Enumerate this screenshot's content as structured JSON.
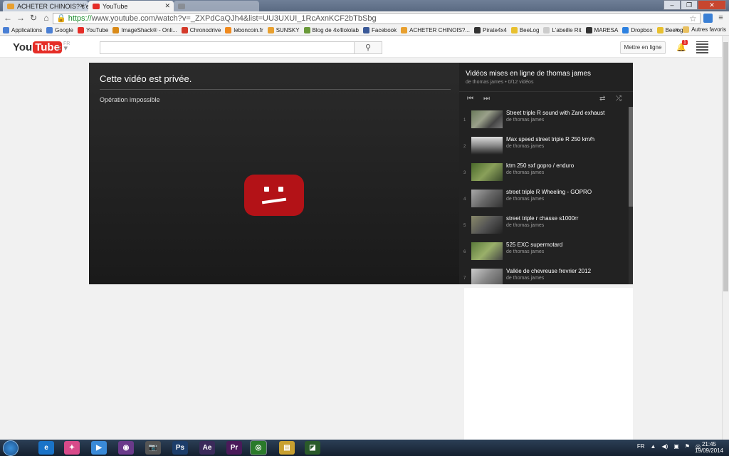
{
  "browser": {
    "tabs": [
      {
        "title": "ACHETER CHINOIS? c'est",
        "active": false,
        "favicon_color": "#e8a030"
      },
      {
        "title": "YouTube",
        "active": true,
        "favicon_color": "#e52d27"
      },
      {
        "title": "",
        "active": false,
        "favicon_color": "#999999"
      }
    ],
    "url_https": "https://",
    "url_rest": "www.youtube.com/watch?v=_ZXPdCaQJh4&list=UU3UXUI_1RcAxnKCF2bTbSbg",
    "bookmarks": [
      {
        "label": "Applications",
        "color": "#4a7fd4"
      },
      {
        "label": "Google",
        "color": "#4a7fd4"
      },
      {
        "label": "YouTube",
        "color": "#e52d27"
      },
      {
        "label": "ImageShack® - Onli...",
        "color": "#d98a18"
      },
      {
        "label": "Chronodrive",
        "color": "#d43a2a"
      },
      {
        "label": "leboncoin.fr",
        "color": "#f08a1e"
      },
      {
        "label": "SUNSKY",
        "color": "#e8a030"
      },
      {
        "label": "Blog de 4x4lololab",
        "color": "#6a9a3a"
      },
      {
        "label": "Facebook",
        "color": "#3b5998"
      },
      {
        "label": "ACHETER CHINOIS?...",
        "color": "#e8a030"
      },
      {
        "label": "Pirate4x4",
        "color": "#333333"
      },
      {
        "label": "BeeLog",
        "color": "#e8c030"
      },
      {
        "label": "L'abeille Rit",
        "color": "#cccccc"
      },
      {
        "label": "MARESA",
        "color": "#333333"
      },
      {
        "label": "Dropbox",
        "color": "#2d81e0"
      },
      {
        "label": "Beelog",
        "color": "#e8c030"
      }
    ],
    "bookmarks_more": "»",
    "bookmarks_other": "Autres favoris"
  },
  "youtube": {
    "logo_you": "You",
    "logo_tube": "Tube",
    "logo_country": "FR",
    "guide_icon": "≡ ▾",
    "search_icon": "⚲",
    "upload_label": "Mettre en ligne",
    "notif_count": "1"
  },
  "player": {
    "title": "Cette vidéo est privée.",
    "message": "Opération impossible"
  },
  "playlist": {
    "title": "Vidéos mises en ligne de thomas james",
    "subtitle": "de thomas james • 0/12 vidéos",
    "items": [
      {
        "num": "1",
        "title": "Street triple R sound with Zard exhaust",
        "by": "de thomas james"
      },
      {
        "num": "2",
        "title": "Max speed street triple R 250 km/h",
        "by": "de thomas james"
      },
      {
        "num": "3",
        "title": "ktm 250 sxf gopro / enduro",
        "by": "de thomas james"
      },
      {
        "num": "4",
        "title": "street triple R Wheeling - GOPRO",
        "by": "de thomas james"
      },
      {
        "num": "5",
        "title": "street triple r chasse s1000rr",
        "by": "de thomas james"
      },
      {
        "num": "6",
        "title": "525 EXC supermotard",
        "by": "de thomas james"
      },
      {
        "num": "7",
        "title": "Vallée de chevreuse frevrier 2012",
        "by": "de thomas james"
      }
    ]
  },
  "taskbar": {
    "apps": [
      "e",
      "✦",
      "▶",
      "◉",
      "📷",
      "Ps",
      "Ae",
      "Pr",
      "◎",
      "▤",
      "◪"
    ],
    "app_colors": [
      "#1a73c8",
      "#d84a8a",
      "#3a8ad8",
      "#6a3a8a",
      "#555555",
      "#1c3d6a",
      "#3a2a5a",
      "#4a1a5a",
      "#2a7a2a",
      "#c8a030",
      "#2a5a2a"
    ],
    "lang": "FR",
    "time": "21:45",
    "date": "19/09/2014"
  }
}
